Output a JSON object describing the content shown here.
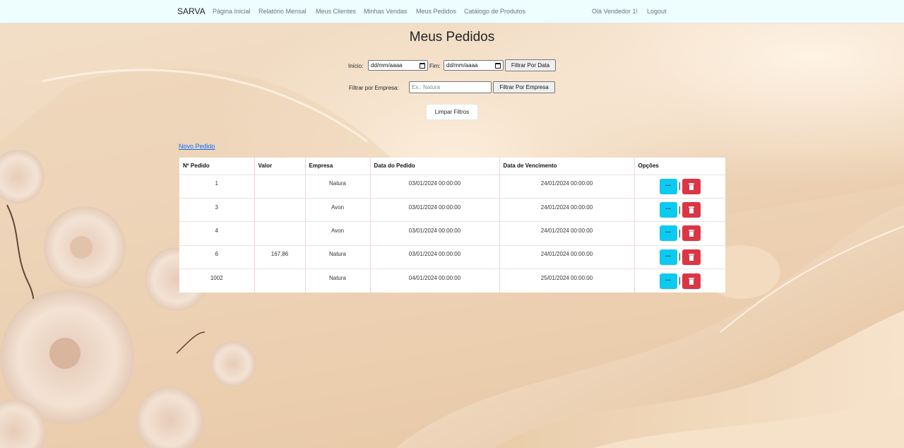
{
  "nav": {
    "brand": "SARVA",
    "links": [
      "Página Inicial",
      "Relatório Mensal",
      "Meus Clientes",
      "Minhas Vendas",
      "Meus Pedidos",
      "Catálogo de Produtos"
    ],
    "greeting": "Olá Vendedor 1!",
    "logout": "Logout"
  },
  "page": {
    "title": "Meus Pedidos"
  },
  "filters": {
    "start_label": "Início:",
    "start_value": "dd/mm/aaaa",
    "end_label": "Fim:",
    "end_value": "dd/mm/aaaa",
    "date_button": "Filtrar Por Data",
    "company_label": "Filtrar por Empresa:",
    "company_placeholder": "Ex.: Natura",
    "company_button": "Filtrar Por Empresa",
    "clear_button": "Limpar Filtros"
  },
  "new_order_link": "Novo Pedido",
  "table": {
    "headers": [
      "Nº Pedido",
      "Valor",
      "Empresa",
      "Data do Pedido",
      "Data de Vencimento",
      "Opções"
    ],
    "rows": [
      {
        "num": "1",
        "valor": "",
        "empresa": "Natura",
        "data_pedido": "03/01/2024 00:00:00",
        "data_venc": "24/01/2024 00:00:00"
      },
      {
        "num": "3",
        "valor": "",
        "empresa": "Avon",
        "data_pedido": "03/01/2024 00:00:00",
        "data_venc": "24/01/2024 00:00:00"
      },
      {
        "num": "4",
        "valor": "",
        "empresa": "Avon",
        "data_pedido": "03/01/2024 00:00:00",
        "data_venc": "24/01/2024 00:00:00"
      },
      {
        "num": "6",
        "valor": "167,86",
        "empresa": "Natura",
        "data_pedido": "03/01/2024 00:00:00",
        "data_venc": "24/01/2024 00:00:00"
      },
      {
        "num": "1002",
        "valor": "",
        "empresa": "Natura",
        "data_pedido": "04/01/2024 00:00:00",
        "data_venc": "25/01/2024 00:00:00"
      }
    ],
    "details_label": "···",
    "separator": "|"
  },
  "colors": {
    "navbar": "#eefdfd",
    "info": "#0dcaf0",
    "danger": "#dc3545",
    "link": "#0d6efd"
  },
  "icons": {
    "details": "ellipsis-icon",
    "delete": "trash-icon"
  }
}
